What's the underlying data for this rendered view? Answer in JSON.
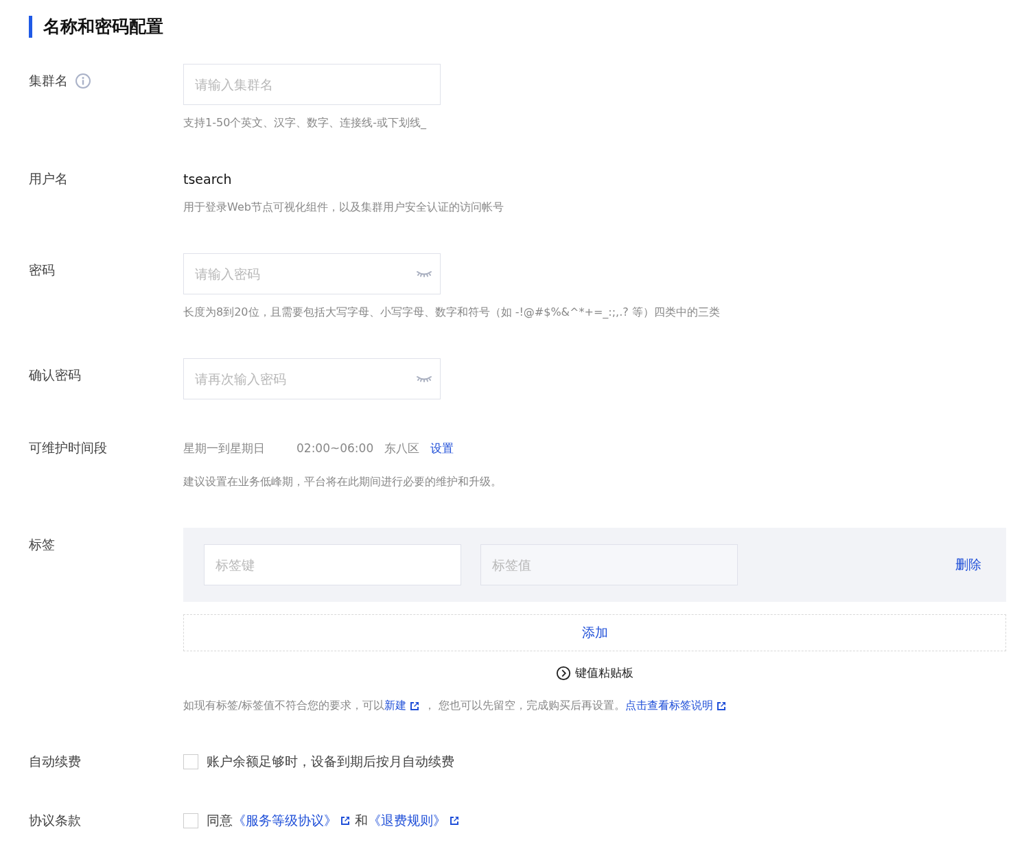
{
  "section_title": "名称和密码配置",
  "rows": [
    {
      "kind": "input",
      "label": "集群名",
      "info": true,
      "placeholder": "请输入集群名",
      "hint": "支持1-50个英文、汉字、数字、连接线-或下划线_"
    },
    {
      "kind": "text",
      "label": "用户名",
      "value": "tsearch",
      "hint": "用于登录Web节点可视化组件，以及集群用户安全认证的访问帐号"
    },
    {
      "kind": "password",
      "label": "密码",
      "placeholder": "请输入密码",
      "hint": "长度为8到20位，且需要包括大写字母、小写字母、数字和符号（如 -!@#$%&^*+=_:;,.? 等）四类中的三类"
    },
    {
      "kind": "password",
      "label": "确认密码",
      "placeholder": "请再次输入密码"
    },
    {
      "kind": "maintenance",
      "label": "可维护时间段",
      "days": "星期一到星期日",
      "time": "02:00~06:00",
      "zone": "东八区",
      "link": "设置",
      "hint": "建议设置在业务低峰期，平台将在此期间进行必要的维护和升级。"
    },
    {
      "kind": "tags",
      "label": "标签",
      "tags": [
        {
          "key_placeholder": "标签键",
          "value_placeholder": "标签值",
          "delete": "删除"
        }
      ],
      "add": "添加",
      "clipboard": "键值粘贴板",
      "hint_parts": [
        {
          "link": false,
          "text": "如现有标签/标签值不符合您的要求，可以"
        },
        {
          "link": true,
          "text": "新建"
        },
        {
          "link": false,
          "text": "，  您也可以先留空，完成购买后再设置。"
        },
        {
          "link": true,
          "text": "点击查看标签说明"
        }
      ]
    },
    {
      "kind": "checkbox",
      "label": "自动续费",
      "checked": false,
      "parts": [
        {
          "link": false,
          "text": "账户余额足够时，设备到期后按月自动续费"
        }
      ]
    },
    {
      "kind": "checkbox",
      "label": "协议条款",
      "checked": false,
      "parts": [
        {
          "link": false,
          "text": "同意"
        },
        {
          "link": true,
          "text": "《服务等级协议》"
        },
        {
          "link": false,
          "text": "和"
        },
        {
          "link": true,
          "text": "《退费规则》"
        }
      ]
    }
  ]
}
